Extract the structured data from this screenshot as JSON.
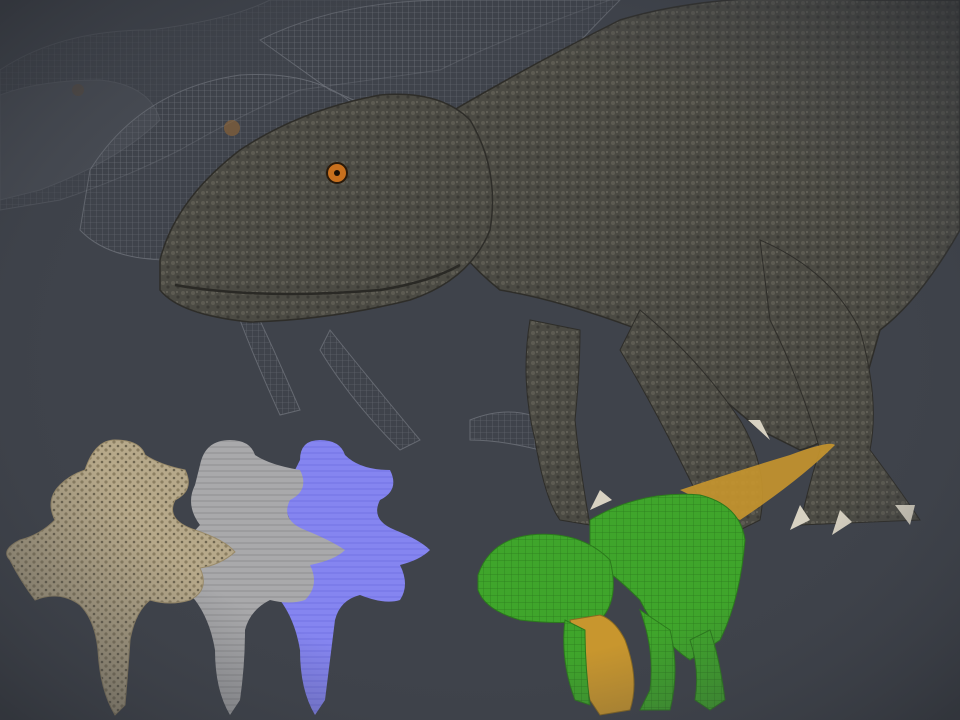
{
  "scene": {
    "background_color": "#3f434b",
    "layers": [
      {
        "name": "wireframe-ghost-back",
        "opacity": 0.35,
        "color": "#6a6e76"
      },
      {
        "name": "wireframe-ghost-mid",
        "opacity": 0.55,
        "color": "#7a7e86"
      },
      {
        "name": "textured-trex",
        "color": "#4e4c44",
        "eye_color": "#c8701e"
      },
      {
        "name": "green-uv-proxy-model",
        "color": "#3fa52b",
        "accent": "#c8962e"
      }
    ],
    "texture_maps": [
      {
        "name": "diffuse-map",
        "color": "#b7a98a"
      },
      {
        "name": "displacement-map",
        "color": "#a9a9ab"
      },
      {
        "name": "normal-map",
        "color": "#8585f0"
      }
    ]
  }
}
